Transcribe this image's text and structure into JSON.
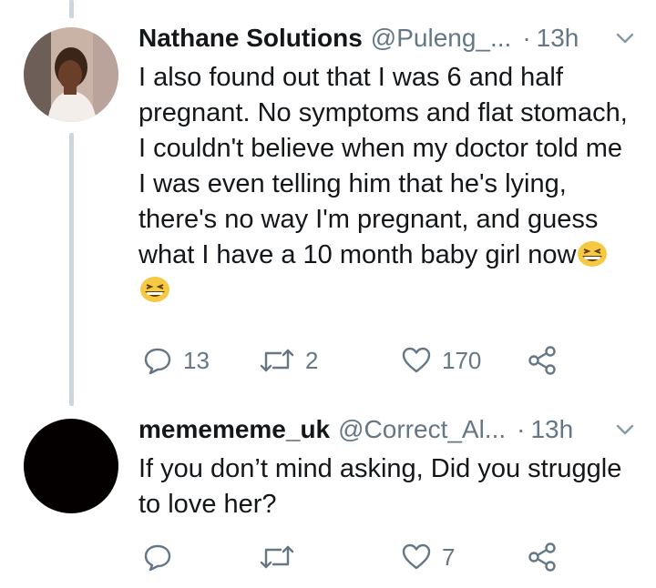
{
  "tweets": [
    {
      "name": "Nathane Solutions",
      "handle": "@Puleng_...",
      "dot": "·",
      "time": "13h",
      "text": "I also found out that I was 6 and half pregnant. No symptoms and flat stomach, I couldn't believe when my doctor told me I was even telling him that he's lying, there's no way I'm pregnant, and guess what I have a 10 month baby girl now",
      "emoji": [
        "grinning-squinting-face",
        "grinning-squinting-face"
      ],
      "actions": {
        "replies": "13",
        "retweets": "2",
        "likes": "170"
      }
    },
    {
      "name": "memememe_uk",
      "handle": "@Correct_Al...",
      "dot": "·",
      "time": "13h",
      "text": "If you don’t mind asking, Did you struggle to love her?",
      "actions": {
        "replies": "",
        "retweets": "",
        "likes": "7"
      }
    }
  ],
  "colors": {
    "text": "#14171a",
    "secondary": "#657786",
    "thread": "#ccd6dd",
    "icon": "#657786"
  }
}
